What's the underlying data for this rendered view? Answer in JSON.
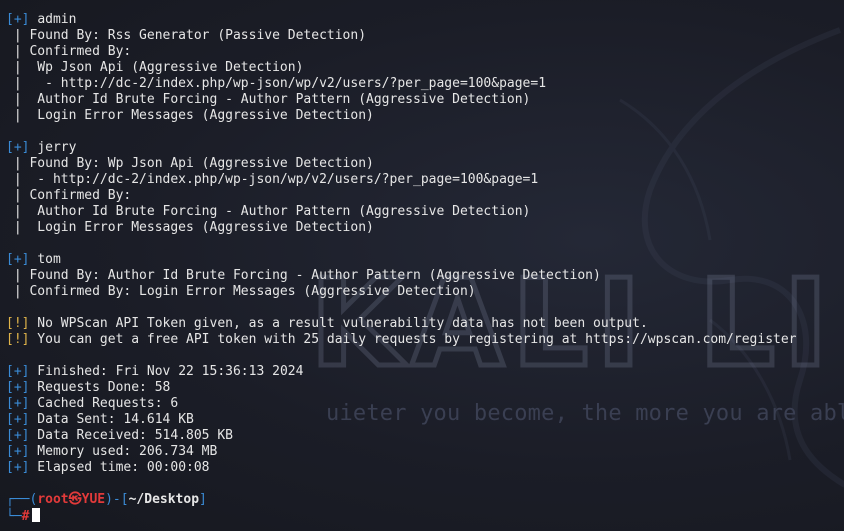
{
  "background": {
    "logo_text": "KALI LINUX",
    "tagline": "uieter you become, the more you are able to he"
  },
  "colors": {
    "background": "#1b1d27",
    "info_bracket": "#3a8bd6",
    "warning_bracket": "#e0b44a",
    "root": "#e23a3a",
    "text": "#e6e6e6"
  },
  "users": [
    {
      "marker": "[+]",
      "name": "admin",
      "lines": [
        " | Found By: Rss Generator (Passive Detection)",
        " | Confirmed By:",
        " |  Wp Json Api (Aggressive Detection)",
        " |   - http://dc-2/index.php/wp-json/wp/v2/users/?per_page=100&page=1",
        " |  Author Id Brute Forcing - Author Pattern (Aggressive Detection)",
        " |  Login Error Messages (Aggressive Detection)"
      ]
    },
    {
      "marker": "[+]",
      "name": "jerry",
      "lines": [
        " | Found By: Wp Json Api (Aggressive Detection)",
        " |  - http://dc-2/index.php/wp-json/wp/v2/users/?per_page=100&page=1",
        " | Confirmed By:",
        " |  Author Id Brute Forcing - Author Pattern (Aggressive Detection)",
        " |  Login Error Messages (Aggressive Detection)"
      ]
    },
    {
      "marker": "[+]",
      "name": "tom",
      "lines": [
        " | Found By: Author Id Brute Forcing - Author Pattern (Aggressive Detection)",
        " | Confirmed By: Login Error Messages (Aggressive Detection)"
      ]
    }
  ],
  "warnings": [
    {
      "marker": "[!]",
      "text": " No WPScan API Token given, as a result vulnerability data has not been output."
    },
    {
      "marker": "[!]",
      "text": " You can get a free API token with 25 daily requests by registering at https://wpscan.com/register"
    }
  ],
  "stats": [
    {
      "marker": "[+]",
      "text": " Finished: Fri Nov 22 15:36:13 2024"
    },
    {
      "marker": "[+]",
      "text": " Requests Done: 58"
    },
    {
      "marker": "[+]",
      "text": " Cached Requests: 6"
    },
    {
      "marker": "[+]",
      "text": " Data Sent: 14.614 KB"
    },
    {
      "marker": "[+]",
      "text": " Data Received: 514.805 KB"
    },
    {
      "marker": "[+]",
      "text": " Memory used: 206.734 MB"
    },
    {
      "marker": "[+]",
      "text": " Elapsed time: 00:00:08"
    }
  ],
  "prompt": {
    "corner_top": "┌──(",
    "user": "root㉿YUE",
    "mid": ")-[",
    "path": "~/Desktop",
    "end": "]",
    "corner_bottom": "└─",
    "symbol": "#"
  }
}
